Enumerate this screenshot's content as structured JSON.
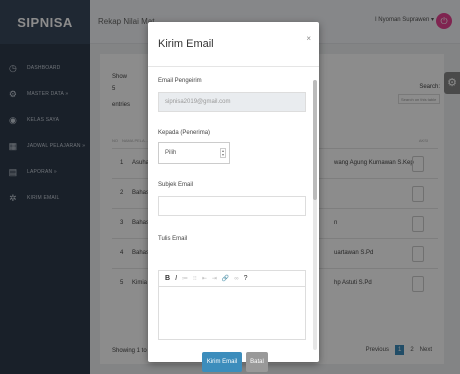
{
  "app": {
    "brand": "SIPNISA"
  },
  "sidebar": {
    "items": [
      {
        "label": "DASHBOARD",
        "icon": "dashboard-icon"
      },
      {
        "label": "MASTER DATA »",
        "icon": "cog-icon"
      },
      {
        "label": "KELAS SAYA",
        "icon": "user-icon"
      },
      {
        "label": "JADWAL PELAJARAN »",
        "icon": "calendar-icon"
      },
      {
        "label": "LAPORAN »",
        "icon": "file-icon"
      },
      {
        "label": "KIRIM EMAIL",
        "icon": "gear-icon"
      }
    ]
  },
  "topbar": {
    "breadcrumb": "Rekap Nilai Mat",
    "user": "I Nyoman Suprawen ▾"
  },
  "table": {
    "show_label": "Show",
    "show_value": "5",
    "entries_label": "entries",
    "search_label": "Search:",
    "search_placeholder": "Search on this table",
    "headers": {
      "no": "NO",
      "nama": "NAMA PELA...",
      "aksi": "AKSI"
    },
    "rows": [
      {
        "no": "1",
        "nama": "Asuhan K",
        "guru": "wang Agung Kurnawan S.Kep"
      },
      {
        "no": "2",
        "nama": "Bahasa B",
        "guru": ""
      },
      {
        "no": "3",
        "nama": "Bahasa I",
        "guru": "n"
      },
      {
        "no": "4",
        "nama": "Bahasa J",
        "guru": "uartawan S.Pd"
      },
      {
        "no": "5",
        "nama": "Kimia",
        "guru": "hp Astuti S.Pd"
      }
    ],
    "showing": "Showing 1 to 5",
    "pager": {
      "previous": "Previous",
      "p1": "1",
      "p2": "2",
      "next": "Next"
    }
  },
  "modal": {
    "title": "Kirim Email",
    "close": "×",
    "fields": {
      "sender_label": "Email Pengeirim",
      "sender_value": "sipnisa2019@gmail.com",
      "to_label": "Kepada (Penerima)",
      "to_value": "Pilih",
      "subject_label": "Subjek Email",
      "subject_value": "",
      "body_label": "Tulis Email"
    },
    "editor_toolbar": [
      "B",
      "I",
      "≔",
      "⁝⁝",
      "⇤",
      "⇥",
      "🔗",
      "∞",
      "?"
    ],
    "buttons": {
      "send": "Kirim Email",
      "cancel": "Batal"
    }
  }
}
